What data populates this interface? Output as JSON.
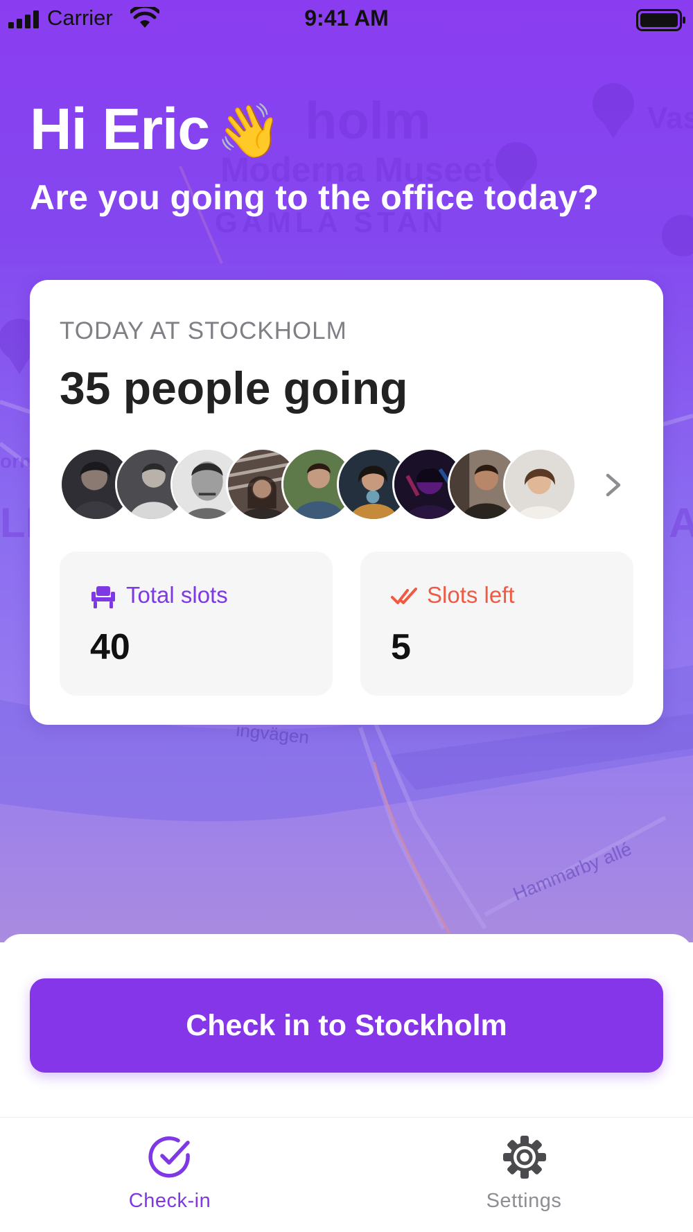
{
  "status_bar": {
    "carrier": "Carrier",
    "time": "9:41 AM"
  },
  "header": {
    "greeting": "Hi Eric",
    "wave_emoji": "👋",
    "question": "Are you going to the office today?"
  },
  "map": {
    "labels": [
      "holm",
      "Moderna Museet",
      "GAMLA STAN",
      "ingvägen",
      "Hammarby allé",
      "Vas",
      "orns",
      "LL",
      "A"
    ]
  },
  "office_card": {
    "overline": "TODAY AT STOCKHOLM",
    "people_count_text": "35 people going",
    "avatars": [
      {
        "name": "avatar-1",
        "color": "#3a3a40"
      },
      {
        "name": "avatar-2",
        "color": "#5a5a5e"
      },
      {
        "name": "avatar-3",
        "color": "#c8c8c8"
      },
      {
        "name": "avatar-4",
        "color": "#6e5a52"
      },
      {
        "name": "avatar-5",
        "color": "#4a6680"
      },
      {
        "name": "avatar-6",
        "color": "#2f3a48"
      },
      {
        "name": "avatar-7",
        "color": "#3b1a5c"
      },
      {
        "name": "avatar-8",
        "color": "#6a5048"
      },
      {
        "name": "avatar-9",
        "color": "#d8d4cf"
      }
    ],
    "more_icon": "chevron-right-icon",
    "total_slots": {
      "label": "Total slots",
      "value": "40",
      "icon": "chair-icon"
    },
    "slots_left": {
      "label": "Slots left",
      "value": "5",
      "icon": "double-check-icon"
    }
  },
  "cta": {
    "label": "Check in to Stockholm"
  },
  "tabbar": {
    "items": [
      {
        "label": "Check-in",
        "icon": "check-circle-icon",
        "active": true
      },
      {
        "label": "Settings",
        "icon": "gear-icon",
        "active": false
      }
    ]
  },
  "colors": {
    "brand_purple": "#8436e8",
    "accent_orange": "#ef5a43",
    "muted_gray": "#8d8d92"
  }
}
